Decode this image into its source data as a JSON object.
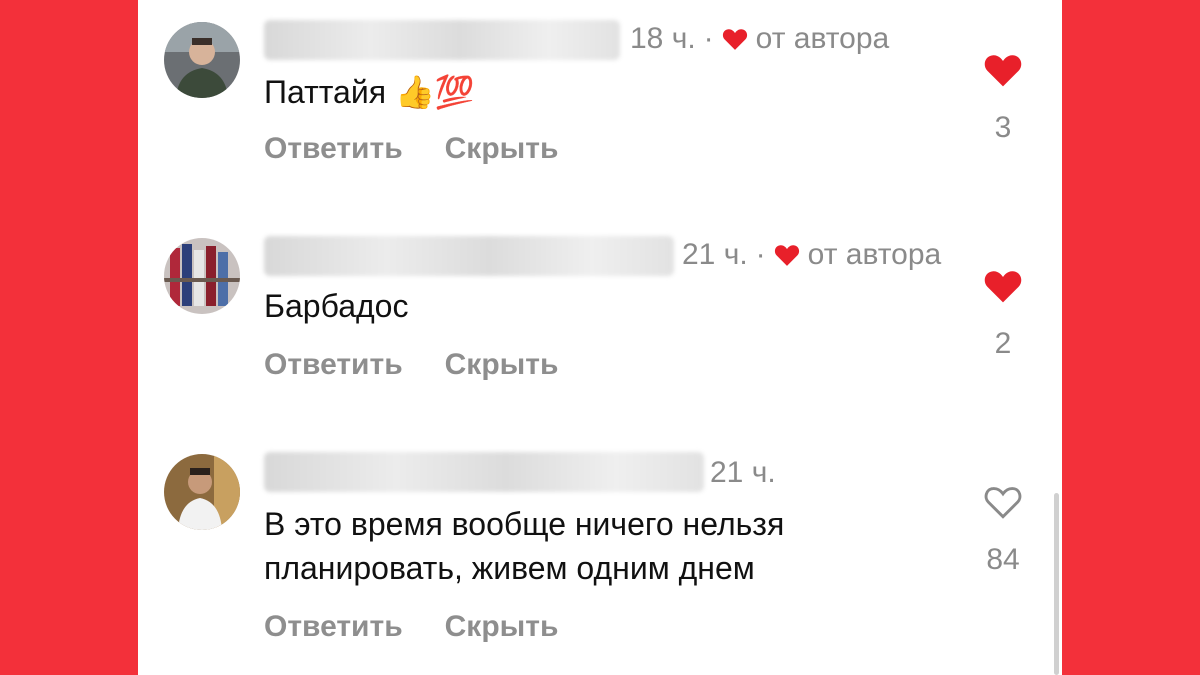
{
  "colors": {
    "accent": "#f3303a",
    "heart": "#e8202a",
    "meta": "#8a8a8a"
  },
  "comments": [
    {
      "time": "18 ч.",
      "separator": "·",
      "author_badge": "от автора",
      "text_lines": [
        "Паттайя 👍💯"
      ],
      "reply": "Ответить",
      "hide": "Скрыть",
      "liked": true,
      "likes": "3"
    },
    {
      "time": "21 ч.",
      "separator": "·",
      "author_badge": "от автора",
      "text_lines": [
        "Барбадос"
      ],
      "reply": "Ответить",
      "hide": "Скрыть",
      "liked": true,
      "likes": "2"
    },
    {
      "time": "21 ч.",
      "text_lines": [
        "В это время вообще ничего нельзя",
        "планировать, живем одним днем"
      ],
      "reply": "Ответить",
      "hide": "Скрыть",
      "liked": false,
      "likes": "84"
    }
  ]
}
